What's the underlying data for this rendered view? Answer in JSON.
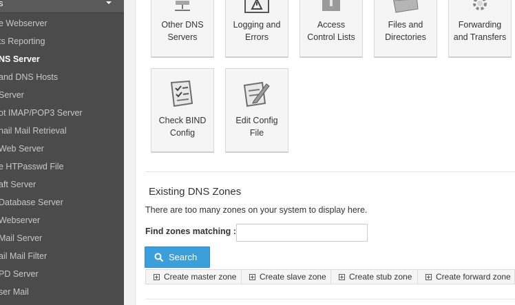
{
  "sidebar": {
    "header": "s",
    "items": [
      {
        "label": "e Webserver",
        "active": false
      },
      {
        "label": "ts Reporting",
        "active": false
      },
      {
        "label": "NS Server",
        "active": true
      },
      {
        "label": "and DNS Hosts",
        "active": false
      },
      {
        "label": "Server",
        "active": false
      },
      {
        "label": "ot IMAP/POP3 Server",
        "active": false
      },
      {
        "label": "nail Mail Retrieval",
        "active": false
      },
      {
        "label": " Web Server",
        "active": false
      },
      {
        "label": "e HTPasswd File",
        "active": false
      },
      {
        "label": "aft Server",
        "active": false
      },
      {
        "label": " Database Server",
        "active": false
      },
      {
        "label": "Webserver",
        "active": false
      },
      {
        "label": " Mail Server",
        "active": false
      },
      {
        "label": "ail Mail Filter",
        "active": false
      },
      {
        "label": "PD Server",
        "active": false
      },
      {
        "label": "ser Mail",
        "active": false
      }
    ]
  },
  "tiles_row1": [
    {
      "line1": "Other DNS",
      "line2": "Servers",
      "icon": "servers-icon"
    },
    {
      "line1": "Logging and",
      "line2": "Errors",
      "icon": "warning-icon"
    },
    {
      "line1": "Access",
      "line2": "Control Lists",
      "icon": "lock-icon"
    },
    {
      "line1": "Files and",
      "line2": "Directories",
      "icon": "folder-icon"
    },
    {
      "line1": "Forwarding",
      "line2": "and Transfers",
      "icon": "gear-icon"
    }
  ],
  "tiles_row2": [
    {
      "line1": "Check BIND",
      "line2": "Config",
      "icon": "checklist-icon"
    },
    {
      "line1": "Edit Config",
      "line2": "File",
      "icon": "edit-document-icon"
    }
  ],
  "zones": {
    "title": "Existing DNS Zones",
    "note": "There are too many zones on your system to display here.",
    "find_label": "Find zones matching :",
    "find_value": "",
    "search_label": "Search",
    "create_links": [
      "Create master zone",
      "Create slave zone",
      "Create stub zone",
      "Create forward zone"
    ]
  }
}
